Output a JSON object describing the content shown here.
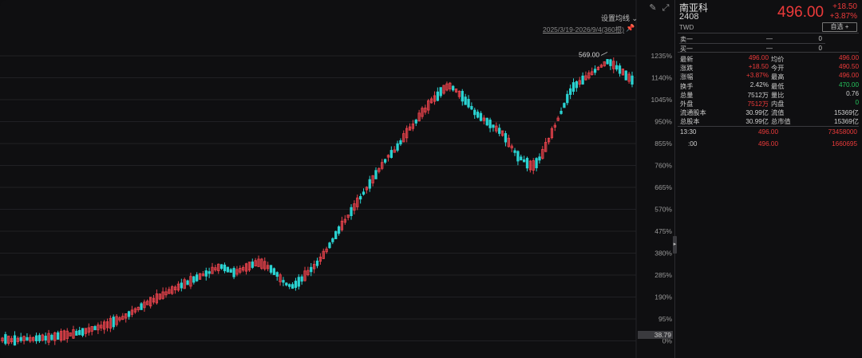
{
  "toolbar": {
    "draw_icon": "pencil-icon",
    "fullscreen_icon": "expand-icon",
    "ma_setting_label": "设置均线",
    "range_label": "2025/3/19-2026/9/4(360根)"
  },
  "chart_data": {
    "type": "candlestick",
    "y_axis_labels": [
      "1235%",
      "1140%",
      "1045%",
      "950%",
      "855%",
      "760%",
      "665%",
      "570%",
      "475%",
      "380%",
      "285%",
      "190%",
      "95%",
      "0%"
    ],
    "current_value_badge": "38.79",
    "high_annotation": "569.00",
    "colors": {
      "up": "#e8434c",
      "down": "#2bd3d2"
    },
    "candle_count": 205,
    "close_series_pct": [
      6,
      8,
      5,
      3,
      2,
      4,
      8,
      10,
      9,
      7,
      8,
      11,
      12,
      14,
      12,
      13,
      15,
      18,
      21,
      22,
      24,
      26,
      28,
      30,
      33,
      36,
      39,
      43,
      47,
      52,
      55,
      58,
      62,
      66,
      70,
      76,
      82,
      88,
      95,
      100,
      108,
      116,
      124,
      132,
      140,
      148,
      156,
      164,
      170,
      176,
      184,
      192,
      198,
      206,
      214,
      220,
      227,
      233,
      240,
      246,
      252,
      258,
      266,
      273,
      279,
      286,
      292,
      296,
      305,
      312,
      318,
      322,
      316,
      309,
      303,
      296,
      299,
      306,
      312,
      318,
      324,
      330,
      336,
      338,
      334,
      328,
      320,
      312,
      300,
      288,
      271,
      258,
      246,
      240,
      236,
      245,
      256,
      268,
      282,
      296,
      309,
      322,
      336,
      354,
      372,
      392,
      414,
      436,
      458,
      480,
      500,
      520,
      540,
      560,
      580,
      600,
      620,
      640,
      660,
      680,
      700,
      720,
      740,
      760,
      780,
      800,
      810,
      822,
      840,
      860,
      880,
      900,
      920,
      930,
      950,
      970,
      990,
      1000,
      1020,
      1040,
      1050,
      1060,
      1080,
      1090,
      1100,
      1104,
      1095,
      1085,
      1070,
      1060,
      1040,
      1030,
      1010,
      990,
      980,
      970,
      960,
      950,
      940,
      930,
      920,
      910,
      900,
      880,
      860,
      840,
      820,
      800,
      790,
      780,
      770,
      760,
      760,
      770,
      790,
      810,
      840,
      870,
      900,
      930,
      960,
      990,
      1020,
      1050,
      1080,
      1100,
      1110,
      1120,
      1130,
      1140,
      1150,
      1160,
      1170,
      1180,
      1190,
      1200,
      1210,
      1205,
      1195,
      1185,
      1175,
      1165,
      1150,
      1140,
      1130
    ]
  },
  "quote": {
    "name": "南亚科",
    "code": "2408",
    "currency": "TWD",
    "price": "496.00",
    "change_abs": "+18.50",
    "change_pct": "+3.87%",
    "watch_label": "自选 +",
    "orderbook": [
      {
        "label": "卖一",
        "price": "—",
        "qty": "0"
      },
      {
        "label": "买一",
        "price": "—",
        "qty": "0"
      }
    ],
    "stats": [
      {
        "l1": "最新",
        "v1": "496.00",
        "c1": "red",
        "l2": "均价",
        "v2": "496.00",
        "c2": "red"
      },
      {
        "l1": "涨跌",
        "v1": "+18.50",
        "c1": "red",
        "l2": "今开",
        "v2": "490.50",
        "c2": "red"
      },
      {
        "l1": "涨幅",
        "v1": "+3.87%",
        "c1": "red",
        "l2": "最高",
        "v2": "496.00",
        "c2": "red"
      },
      {
        "l1": "换手",
        "v1": "2.42%",
        "c1": "white",
        "l2": "最低",
        "v2": "470.00",
        "c2": "green"
      },
      {
        "l1": "总量",
        "v1": "7512万",
        "c1": "white",
        "l2": "量比",
        "v2": "0.76",
        "c2": "white"
      },
      {
        "l1": "外盘",
        "v1": "7512万",
        "c1": "red",
        "l2": "内盘",
        "v2": "0",
        "c2": "green"
      },
      {
        "l1": "流通股本",
        "v1": "30.99亿",
        "c1": "white",
        "l2": "流值",
        "v2": "15369亿",
        "c2": "white"
      },
      {
        "l1": "总股本",
        "v1": "30.99亿",
        "c1": "white",
        "l2": "总市值",
        "v2": "15369亿",
        "c2": "white"
      }
    ],
    "ticks": [
      {
        "time": "13:30",
        "price": "496.00",
        "vol": "73458000"
      },
      {
        "time": ":00",
        "price": "496.00",
        "vol": "1660695"
      }
    ]
  }
}
